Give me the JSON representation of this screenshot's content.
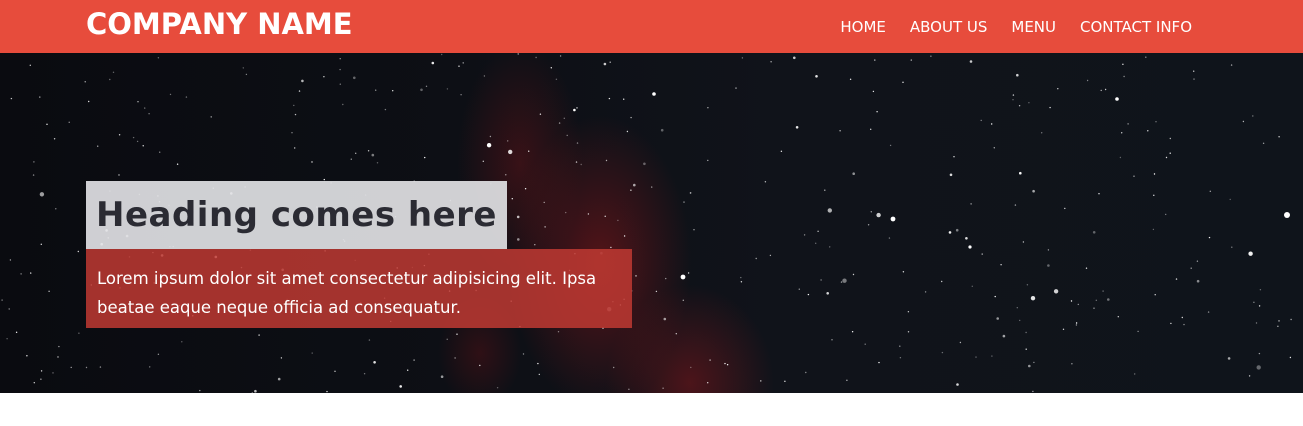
{
  "navbar": {
    "brand": "COMPANY NAME",
    "links": [
      {
        "label": "HOME"
      },
      {
        "label": "ABOUT US"
      },
      {
        "label": "MENU"
      },
      {
        "label": "CONTACT INFO"
      }
    ],
    "background_color": "#e74c3c"
  },
  "hero": {
    "heading": "Heading comes here",
    "paragraph": "Lorem ipsum dolor sit amet consectetur adipisicing elit. Ipsa beatae eaque neque officia ad consequatur.",
    "heading_box_color": "#e1e1e4",
    "paragraph_box_color": "#c03932"
  }
}
